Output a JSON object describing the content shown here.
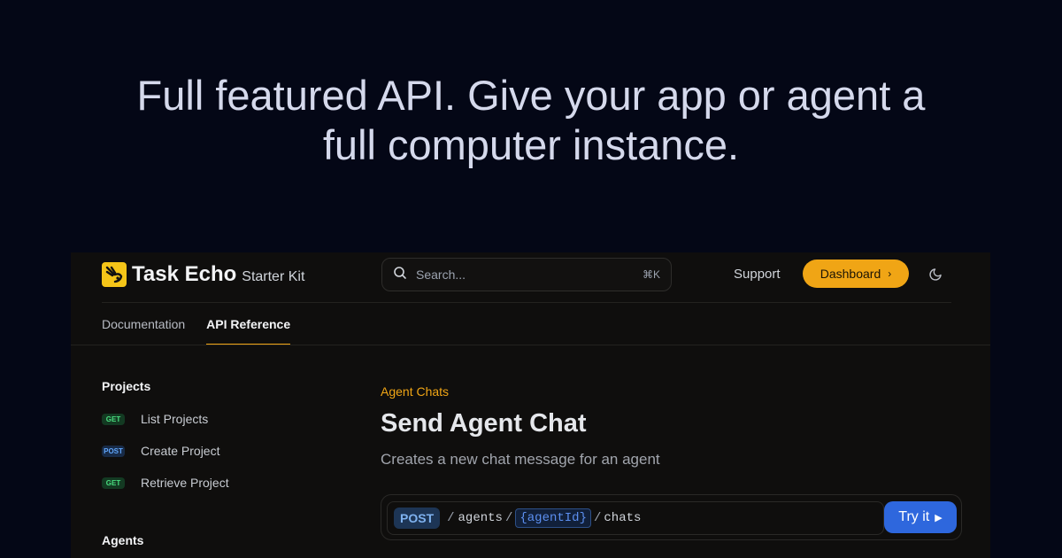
{
  "hero": {
    "line1": "Full featured API. Give your app or agent a",
    "line2": "full computer instance."
  },
  "header": {
    "brand": "Task Echo",
    "brand_sub": "Starter Kit",
    "search_placeholder": "Search...",
    "search_shortcut": "⌘K",
    "support_label": "Support",
    "dashboard_label": "Dashboard",
    "icons": {
      "logo": "task-echo-logo",
      "search": "search-icon",
      "dashboard": "chevron-right-icon",
      "theme": "moon-icon"
    }
  },
  "tabs": [
    {
      "label": "Documentation",
      "active": false
    },
    {
      "label": "API Reference",
      "active": true
    }
  ],
  "sidebar": {
    "projects_heading": "Projects",
    "items": [
      {
        "method": "GET",
        "label": "List Projects"
      },
      {
        "method": "POST",
        "label": "Create Project"
      },
      {
        "method": "GET",
        "label": "Retrieve Project"
      }
    ],
    "agents_heading": "Agents"
  },
  "main": {
    "eyebrow": "Agent Chats",
    "title": "Send Agent Chat",
    "description": "Creates a new chat message for an agent"
  },
  "endpoint": {
    "method": "POST",
    "seg1": "agents",
    "param": "{agentId}",
    "seg2": "chats",
    "try_label": "Try it"
  },
  "colors": {
    "background": "#040716",
    "panel": "#0f0e0d",
    "accent": "#f0a515",
    "primary": "#2e67dd"
  }
}
